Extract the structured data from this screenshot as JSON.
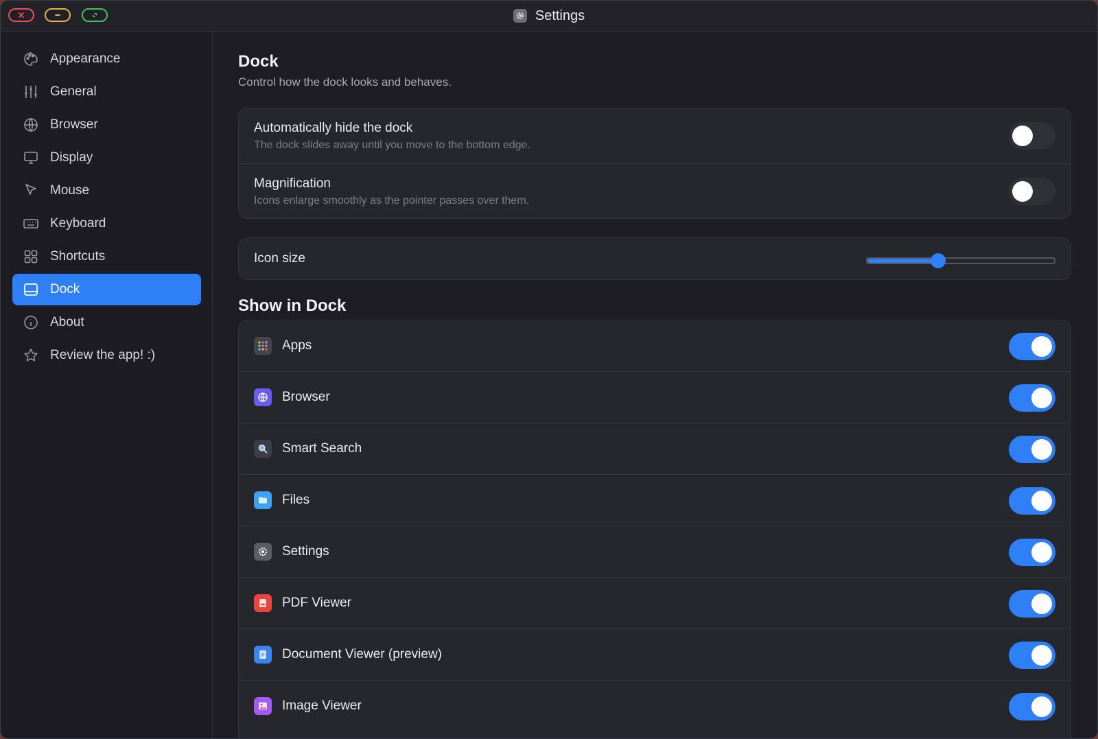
{
  "window": {
    "title": "Settings",
    "title_icon": "gear-icon"
  },
  "sidebar": {
    "items": [
      {
        "label": "Appearance",
        "icon": "palette-icon"
      },
      {
        "label": "General",
        "icon": "sliders-icon"
      },
      {
        "label": "Browser",
        "icon": "globe-icon"
      },
      {
        "label": "Display",
        "icon": "monitor-icon"
      },
      {
        "label": "Mouse",
        "icon": "pointer-icon"
      },
      {
        "label": "Keyboard",
        "icon": "keyboard-icon"
      },
      {
        "label": "Shortcuts",
        "icon": "grid-icon"
      },
      {
        "label": "Dock",
        "icon": "dock-icon",
        "active": true
      },
      {
        "label": "About",
        "icon": "info-icon"
      },
      {
        "label": "Review the app! :)",
        "icon": "star-icon"
      }
    ]
  },
  "main": {
    "title": "Dock",
    "subtitle": "Control how the dock looks and behaves.",
    "behavior": [
      {
        "label": "Automatically hide the dock",
        "description": "The dock slides away until you move to the bottom edge.",
        "enabled": false
      },
      {
        "label": "Magnification",
        "description": "Icons enlarge smoothly as the pointer passes over them.",
        "enabled": false
      }
    ],
    "icon_size": {
      "label": "Icon size",
      "value_fraction": 0.38
    },
    "show_in_dock": {
      "title": "Show in Dock",
      "items": [
        {
          "label": "Apps",
          "icon": "apps-grid-icon",
          "enabled": true
        },
        {
          "label": "Browser",
          "icon": "browser-globe-icon",
          "enabled": true
        },
        {
          "label": "Smart Search",
          "icon": "magnifier-icon",
          "enabled": true
        },
        {
          "label": "Files",
          "icon": "folder-icon",
          "enabled": true
        },
        {
          "label": "Settings",
          "icon": "gear-icon",
          "enabled": true
        },
        {
          "label": "PDF Viewer",
          "icon": "pdf-icon",
          "enabled": true
        },
        {
          "label": "Document Viewer (preview)",
          "icon": "document-icon",
          "enabled": true
        },
        {
          "label": "Image Viewer",
          "icon": "image-icon",
          "enabled": true
        }
      ]
    }
  },
  "colors": {
    "accent": "#2f7ff7",
    "close": "#e8535a",
    "minimize": "#e8b44a",
    "maximize": "#43c35a"
  }
}
